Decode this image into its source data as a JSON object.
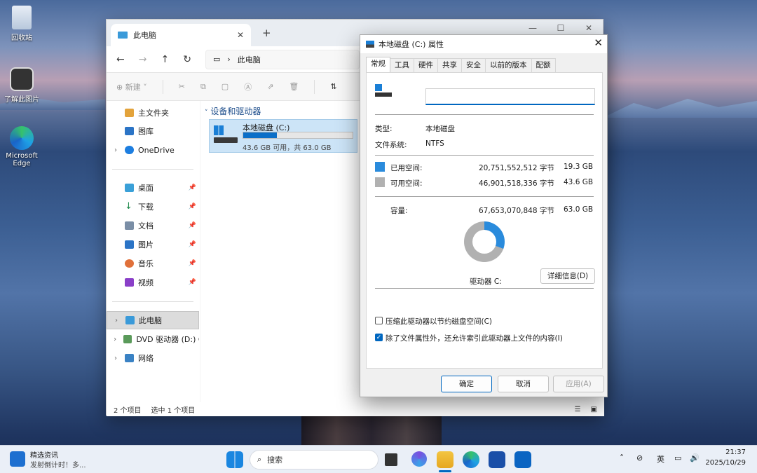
{
  "desktop": {
    "icons": [
      {
        "label": "回收站"
      },
      {
        "label": "了解此图片"
      },
      {
        "label": "Microsoft Edge"
      }
    ]
  },
  "explorer": {
    "tab_title": "此电脑",
    "breadcrumb": "此电脑",
    "toolbar": {
      "new_label": "新建"
    },
    "sidebar": {
      "items": [
        {
          "label": "主文件夹"
        },
        {
          "label": "图库"
        },
        {
          "label": "OneDrive"
        },
        {
          "label": "桌面"
        },
        {
          "label": "下载"
        },
        {
          "label": "文档"
        },
        {
          "label": "图片"
        },
        {
          "label": "音乐"
        },
        {
          "label": "视频"
        },
        {
          "label": "此电脑"
        },
        {
          "label": "DVD 驱动器 (D:) C"
        },
        {
          "label": "网络"
        }
      ]
    },
    "section_header": "设备和驱动器",
    "drive": {
      "name": "本地磁盘 (C:)",
      "detail": "43.6 GB 可用，共 63.0 GB",
      "used_fraction": 0.306
    },
    "status": {
      "count": "2 个项目",
      "selected": "选中 1 个项目"
    }
  },
  "dialog": {
    "title": "本地磁盘 (C:) 属性",
    "tabs": [
      "常规",
      "工具",
      "硬件",
      "共享",
      "安全",
      "以前的版本",
      "配额"
    ],
    "name_value": "",
    "type_label": "类型:",
    "type_value": "本地磁盘",
    "fs_label": "文件系统:",
    "fs_value": "NTFS",
    "used": {
      "label": "已用空间:",
      "bytes": "20,751,552,512 字节",
      "size": "19.3 GB",
      "color": "#2a8bdc"
    },
    "free": {
      "label": "可用空间:",
      "bytes": "46,901,518,336 字节",
      "size": "43.6 GB",
      "color": "#b1b1b1"
    },
    "capacity": {
      "label": "容量:",
      "bytes": "67,653,070,848 字节",
      "size": "63.0 GB"
    },
    "used_fraction": 0.306,
    "drive_label": "驱动器 C:",
    "details_button": "详细信息(D)",
    "compress_label": "压缩此驱动器以节约磁盘空间(C)",
    "index_label": "除了文件属性外，还允许索引此驱动器上文件的内容(I)",
    "ok": "确定",
    "cancel": "取消",
    "apply": "应用(A)"
  },
  "taskbar": {
    "news_title": "精选资讯",
    "news_sub": "发射倒计时！多...",
    "search_placeholder": "搜索",
    "ime_label": "英",
    "time": "21:37",
    "date": "2025/10/29"
  }
}
